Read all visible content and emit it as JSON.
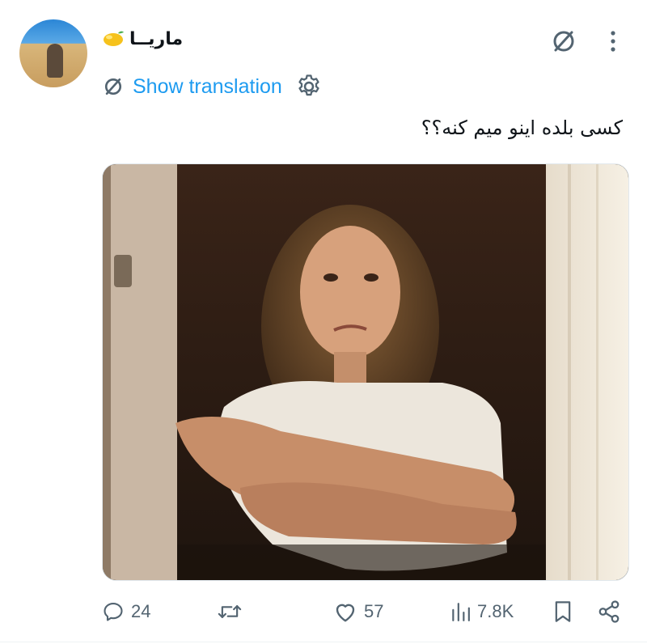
{
  "tweet": {
    "author_name": "ماریــا",
    "author_emoji_icon": "lemon-icon",
    "show_translation_label": "Show translation",
    "text": "کسی بلده اینو میم کنه؟؟",
    "media_alt_icon": "photo"
  },
  "actions": {
    "replies": "24",
    "retweets": "",
    "likes": "57",
    "views": "7.8K"
  },
  "colors": {
    "accent": "#1d9bf0",
    "muted": "#536471",
    "text": "#0f1419"
  }
}
